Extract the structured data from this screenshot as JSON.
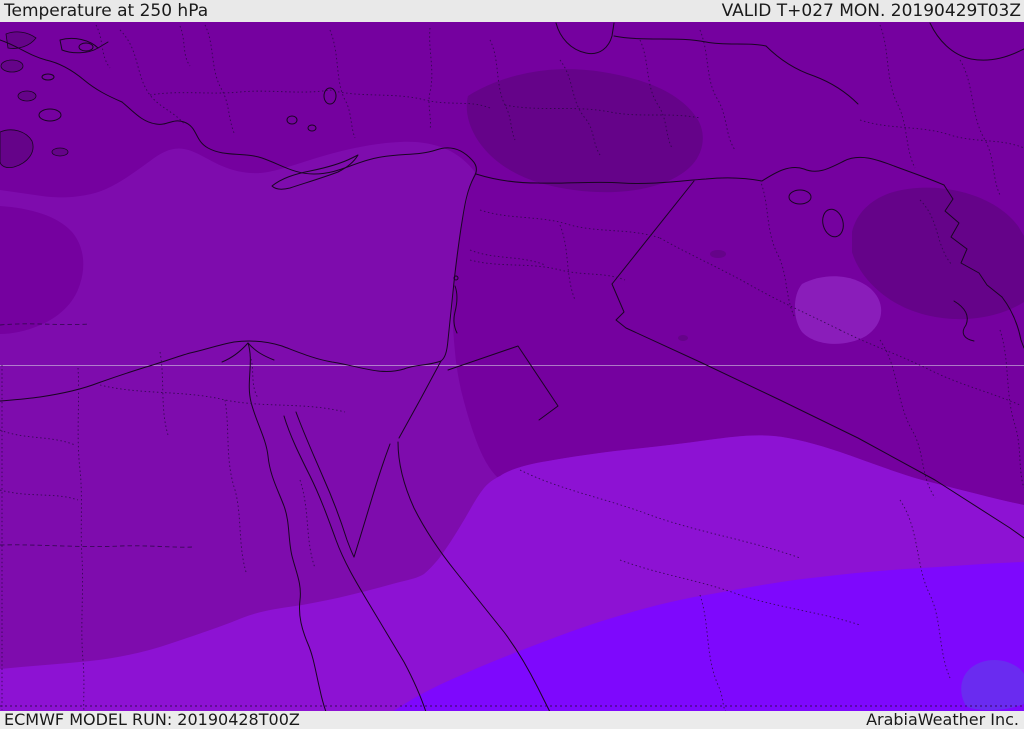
{
  "header": {
    "title": "Temperature at 250 hPa",
    "valid_label": "VALID T+027 MON. 20190429T03Z"
  },
  "footer": {
    "model_run": "ECMWF MODEL RUN: 20190428T00Z",
    "credit": "ArabiaWeather Inc."
  },
  "map": {
    "kind": "filled-contour temperature field over Middle East / Eastern Mediterranean",
    "colors": {
      "band_coldest": "#650389",
      "band_cold": "#75019F",
      "band_mid": "#7E0CAD",
      "band_mild_patch": "#8A1DBA",
      "band_warm": "#8D12D3",
      "band_warmer": "#7E08FD",
      "band_warmest_patch": "#6A2BF0",
      "coastline": "#1A0523",
      "admin_boundary": "#2A0845",
      "bar_background": "#E9E9E9",
      "text": "#1A1A1A"
    }
  }
}
